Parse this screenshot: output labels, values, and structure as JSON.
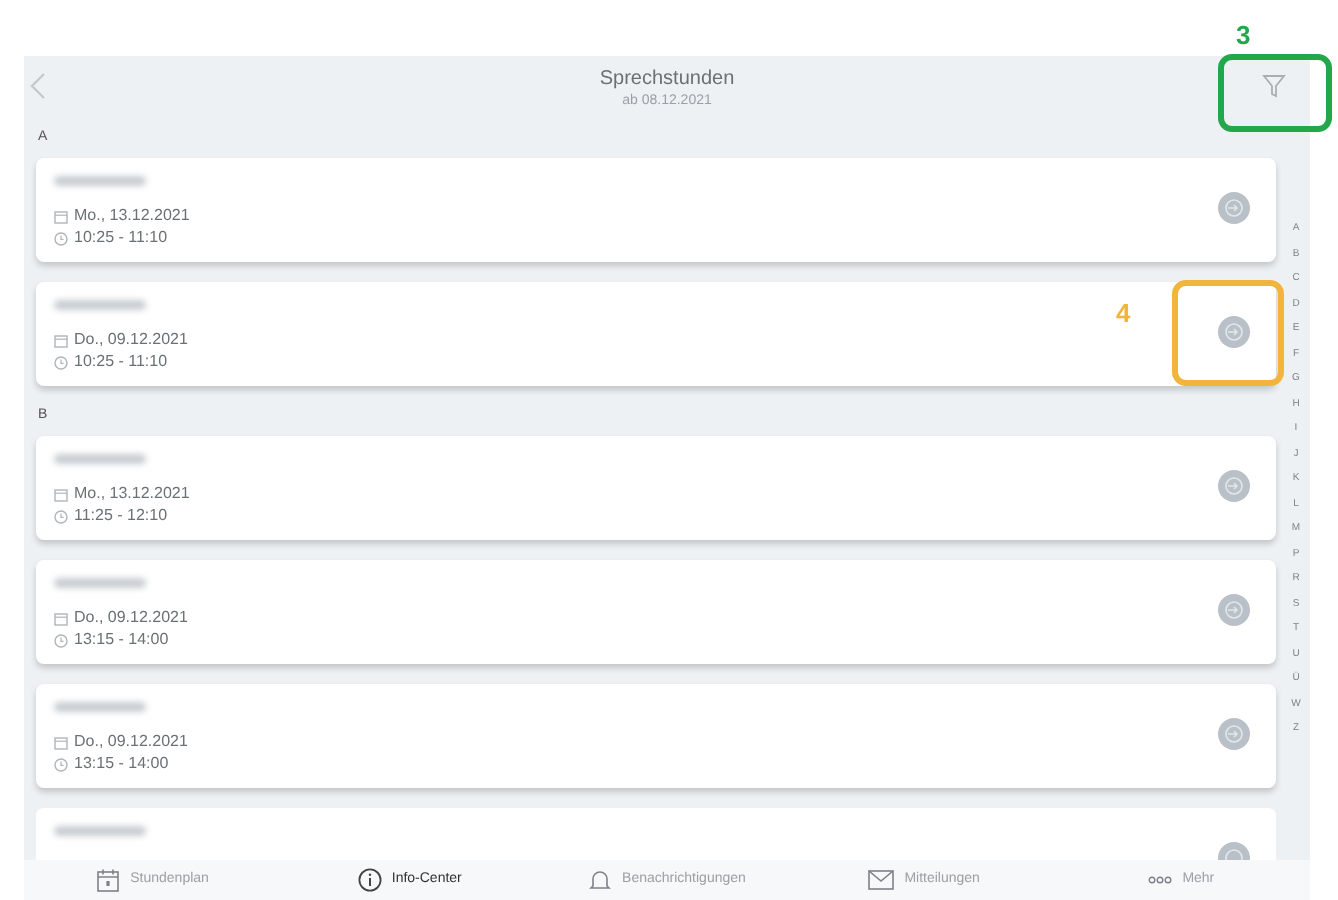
{
  "header": {
    "title": "Sprechstunden",
    "subtitle": "ab 08.12.2021"
  },
  "sections": [
    {
      "letter": "A",
      "entries": [
        {
          "date": "Mo., 13.12.2021",
          "time": "10:25 - 11:10"
        },
        {
          "date": "Do., 09.12.2021",
          "time": "10:25 - 11:10"
        }
      ]
    },
    {
      "letter": "B",
      "entries": [
        {
          "date": "Mo., 13.12.2021",
          "time": "11:25 - 12:10"
        },
        {
          "date": "Do., 09.12.2021",
          "time": "13:15 - 14:00"
        },
        {
          "date": "Do., 09.12.2021",
          "time": "13:15 - 14:00"
        },
        {
          "kind": "partial"
        }
      ]
    }
  ],
  "index_letters": [
    "A",
    "B",
    "C",
    "D",
    "E",
    "F",
    "G",
    "H",
    "I",
    "J",
    "K",
    "L",
    "M",
    "P",
    "R",
    "S",
    "T",
    "U",
    "Ü",
    "W",
    "Z"
  ],
  "tabs": [
    {
      "label": "Stundenplan",
      "kind": "calendar",
      "selected": false
    },
    {
      "label": "Info-Center",
      "kind": "info",
      "selected": true
    },
    {
      "label": "Benachrichtigungen",
      "kind": "bell",
      "selected": false
    },
    {
      "label": "Mitteilungen",
      "kind": "mail",
      "selected": false
    },
    {
      "label": "Mehr",
      "kind": "more",
      "selected": false
    }
  ],
  "callouts": [
    {
      "label": "3",
      "color": "#22a84a"
    },
    {
      "label": "4",
      "color": "#f2b43a"
    }
  ]
}
